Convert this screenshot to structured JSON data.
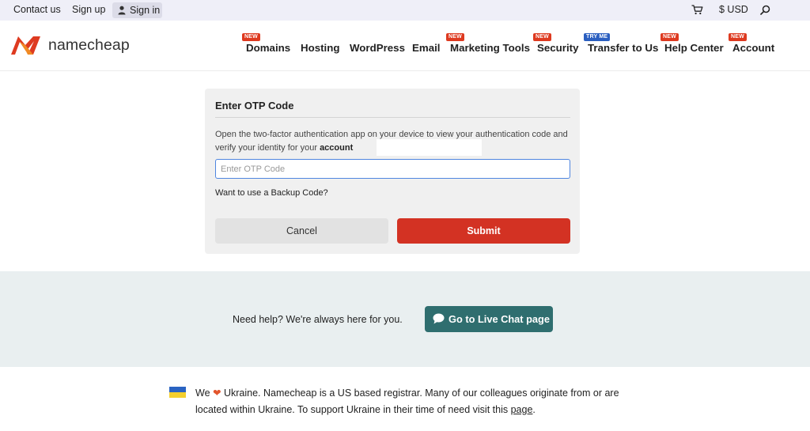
{
  "topbar": {
    "contact_label": "Contact us",
    "signup_label": "Sign up",
    "signin_label": "Sign in",
    "currency_label": "$ USD"
  },
  "brand": {
    "name": "namecheap",
    "accent": "#de3a20"
  },
  "nav": {
    "items": [
      {
        "label": "Domains",
        "badge": "NEW"
      },
      {
        "label": "Hosting",
        "badge": ""
      },
      {
        "label": "WordPress",
        "badge": ""
      },
      {
        "label": "Email",
        "badge": ""
      },
      {
        "label": "Marketing Tools",
        "badge": "NEW"
      },
      {
        "label": "Security",
        "badge": "NEW"
      },
      {
        "label": "Transfer to Us",
        "badge": "TRY ME"
      },
      {
        "label": "Help Center",
        "badge": "NEW"
      },
      {
        "label": "Account",
        "badge": "NEW"
      }
    ]
  },
  "otp": {
    "title": "Enter OTP Code",
    "description": "Open the two-factor authentication app on your device to view your authentication code and verify your identity for your",
    "description_bold": "account",
    "input_placeholder": "Enter OTP Code",
    "input_value": "",
    "backup_link": "Want to use a Backup Code?",
    "cancel_label": "Cancel",
    "submit_label": "Submit",
    "submit_color": "#d33223"
  },
  "help": {
    "text": "Need help? We're always here for you.",
    "chat_button": "Go to Live Chat page",
    "chat_color": "#2f6e6f"
  },
  "ukraine": {
    "text_before": "We",
    "heart": "❤",
    "text_after": "Ukraine. Namecheap is a US based registrar. Many of our colleagues originate from or are located within Ukraine. To support Ukraine in their time of need visit this",
    "link_label": "page",
    "text_end": "."
  }
}
